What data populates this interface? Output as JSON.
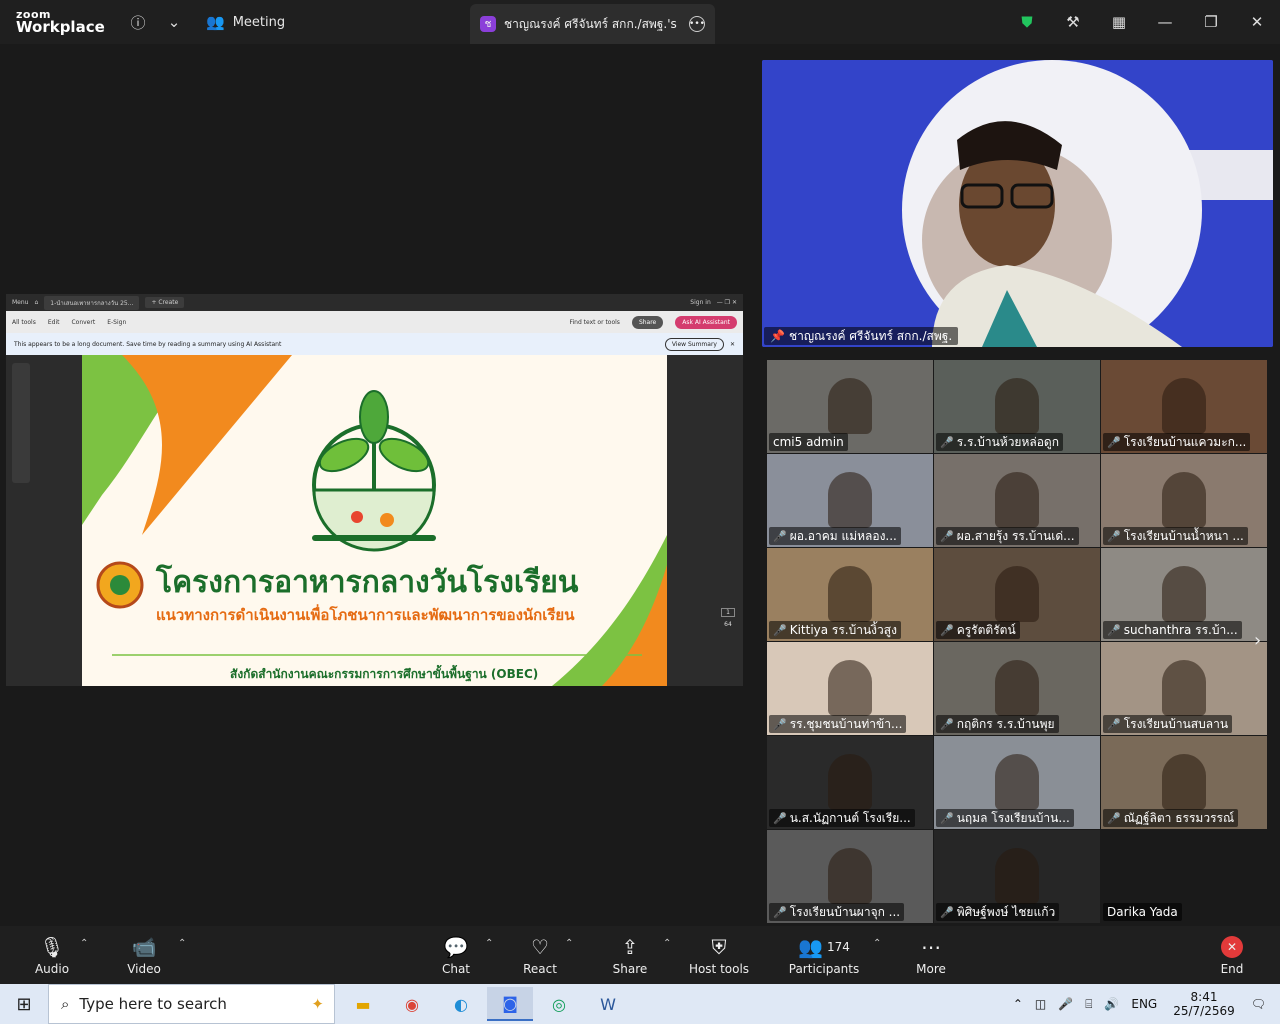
{
  "titlebar": {
    "brand_line1": "zoom",
    "brand_line2": "Workplace",
    "meeting_tab": "Meeting",
    "share_tab_avatar": "ช",
    "share_tab_label": "ชาญณรงค์ ศรีจันทร์ สกก./สพฐ.'s scre"
  },
  "shared_screen": {
    "acrobat_menu": "Menu",
    "acrobat_tab": "1-นำเสนอเพาหารกลางวัน 25...",
    "acrobat_create": "+ Create",
    "sign_in": "Sign in",
    "tools": [
      "All tools",
      "Edit",
      "Convert",
      "E-Sign"
    ],
    "find_text": "Find text or tools",
    "share_btn": "Share",
    "ai_btn": "Ask AI Assistant",
    "banner": "This appears to be a long document. Save time by reading a summary using AI Assistant",
    "view_summary": "View Summary",
    "slide_title": "โครงการอาหารกลางวันโรงเรียน",
    "slide_subtitle": "แนวทางการดำเนินงานเพื่อโภชนาการและพัฒนาการของนักเรียน",
    "slide_footer": "สังกัดสำนักงานคณะกรรมการการศึกษาขั้นพื้นฐาน (OBEC)",
    "page_current": "1",
    "page_total": "64"
  },
  "speaker": {
    "name": "ชาญณรงค์ ศรีจันทร์ สกก./สพฐ."
  },
  "gallery": [
    {
      "name": "cmi5 admin",
      "muted": false,
      "bg": "#6b6a66"
    },
    {
      "name": "ร.ร.บ้านห้วยหล่อดูก",
      "muted": true,
      "bg": "#5a5f5a"
    },
    {
      "name": "โรงเรียนบ้านแควมะก...",
      "muted": true,
      "bg": "#6a4a35"
    },
    {
      "name": "ผอ.อาคม แม่หลอง...",
      "muted": true,
      "bg": "#8a8f9a"
    },
    {
      "name": "ผอ.สายรุ้ง รร.บ้านเด่...",
      "muted": true,
      "bg": "#77706a"
    },
    {
      "name": "โรงเรียนบ้านน้ำหนา ...",
      "muted": true,
      "bg": "#8a7a6e"
    },
    {
      "name": "Kittiya รร.บ้านงิ้วสูง",
      "muted": true,
      "bg": "#9a8060"
    },
    {
      "name": "ครูรัตติรัตน์",
      "muted": true,
      "bg": "#5d4d3e"
    },
    {
      "name": "suchanthra รร.บ้า...",
      "muted": true,
      "bg": "#8e8a84"
    },
    {
      "name": "รร.ชุมชนบ้านท่าข้า...",
      "muted": true,
      "bg": "#d8c8b8"
    },
    {
      "name": "กฤติกร ร.ร.บ้านพุย",
      "muted": true,
      "bg": "#6a6760"
    },
    {
      "name": "โรงเรียนบ้านสบลาน",
      "muted": true,
      "bg": "#a39485"
    },
    {
      "name": "น.ส.นัฏกานต์ โรงเรีย...",
      "muted": true,
      "bg": "#2a2a2a"
    },
    {
      "name": "นฤมล โรงเรียนบ้าน...",
      "muted": true,
      "bg": "#8a8f96"
    },
    {
      "name": "ณัฏฐ์ลิตา ธรรมวรรณ์",
      "muted": true,
      "bg": "#7a6a58"
    },
    {
      "name": "โรงเรียนบ้านผาจุก ...",
      "muted": true,
      "bg": "#5a5a5a"
    },
    {
      "name": "พิศิษฐ์พงษ์ ไชยแก้ว",
      "muted": true,
      "bg": "#262626"
    },
    {
      "name": "Darika Yada",
      "muted": false,
      "bg": "#1a1a1a"
    }
  ],
  "controls": {
    "audio": "Audio",
    "video": "Video",
    "chat": "Chat",
    "react": "React",
    "share": "Share",
    "host_tools": "Host tools",
    "participants": "Participants",
    "participants_count": "174",
    "more": "More",
    "end": "End"
  },
  "taskbar": {
    "search_placeholder": "Type here to search",
    "language": "ENG",
    "time": "8:41",
    "date": "25/7/2569"
  },
  "colors": {
    "accent_green": "#1b6e2a",
    "accent_orange": "#e56b12",
    "end_red": "#e23a3a",
    "speaker_bg": "#3344c9"
  }
}
